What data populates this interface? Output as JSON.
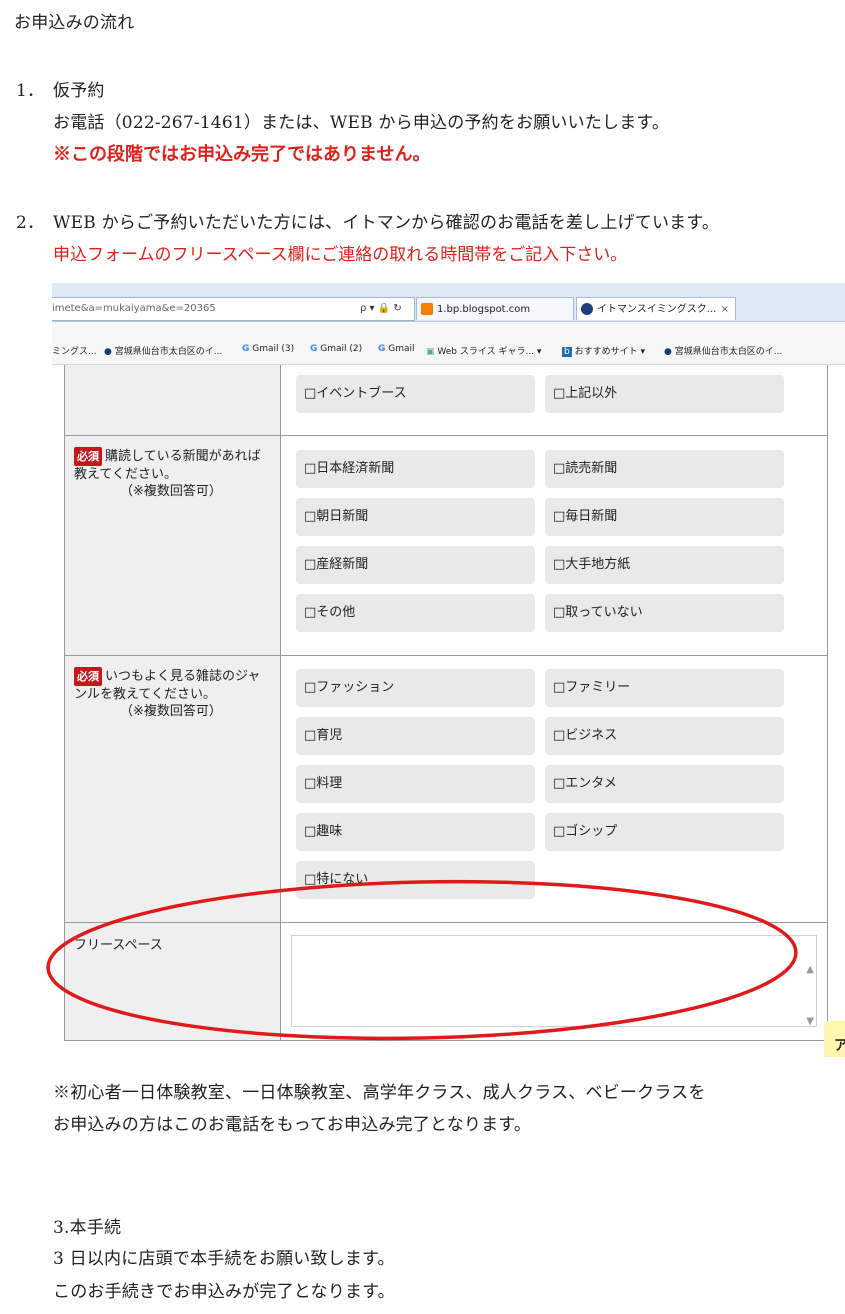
{
  "heading": "お申込みの流れ",
  "step1": {
    "number": "1．",
    "title": "仮予約",
    "line": "お電話（022-267-1461）または、WEB から申込の予約をお願いいたします。",
    "warning": "※この段階ではお申込み完了ではありません。"
  },
  "step2": {
    "number": "2．",
    "line": "WEB からご予約いただいた方には、イトマンから確認のお電話を差し上げています。",
    "note": "申込フォームのフリースペース欄にご連絡の取れる時間帯をご記入下さい。"
  },
  "browser": {
    "url": "imete&a=mukaiyama&e=20365",
    "url_icons": "ρ ▾ 🔒 ↻",
    "tab1": "1.bp.blogspot.com",
    "tab2": "イトマンスイミングスク...",
    "tab_close": "×",
    "bookmarks": [
      "ミングス...",
      "宮城県仙台市太白区のイ...",
      "Gmail (3)",
      "Gmail (2)",
      "Gmail",
      "Web スライス ギャラ... ▾",
      "おすすめサイト ▾",
      "宮城県仙台市太白区のイ..."
    ],
    "g_letter": "G"
  },
  "form": {
    "row0_options": [
      "□イベントブース",
      "□上記以外"
    ],
    "required_badge": "必須",
    "q1_label": "購読している新聞があれば教えてください。",
    "q1_note": "（※複数回答可）",
    "q1_options": [
      "□日本経済新聞",
      "□読売新聞",
      "□朝日新聞",
      "□毎日新聞",
      "□産経新聞",
      "□大手地方紙",
      "□その他",
      "□取っていない"
    ],
    "q2_label": "いつもよく見る雑誌のジャンルを教えてください。",
    "q2_note": "（※複数回答可）",
    "q2_options": [
      "□ファッション",
      "□ファミリー",
      "□育児",
      "□ビジネス",
      "□料理",
      "□エンタメ",
      "□趣味",
      "□ゴシップ",
      "□特にない"
    ],
    "free_space_label": "フリースペース",
    "side_tab_letter": "ア"
  },
  "after_note": {
    "line1": "※初心者一日体験教室、一日体験教室、高学年クラス、成人クラス、ベビークラスを",
    "line2": "お申込みの方はこのお電話をもってお申込み完了となります。"
  },
  "step3": {
    "title": "3.本手続",
    "line1": "3 日以内に店頭で本手続をお願い致します。",
    "line2": "このお手続きでお申込みが完了となります。"
  },
  "colors": {
    "highlight_red": "#e0211b",
    "required_badge": "#c8161d",
    "annotation_ellipse": "#e01a1a"
  }
}
